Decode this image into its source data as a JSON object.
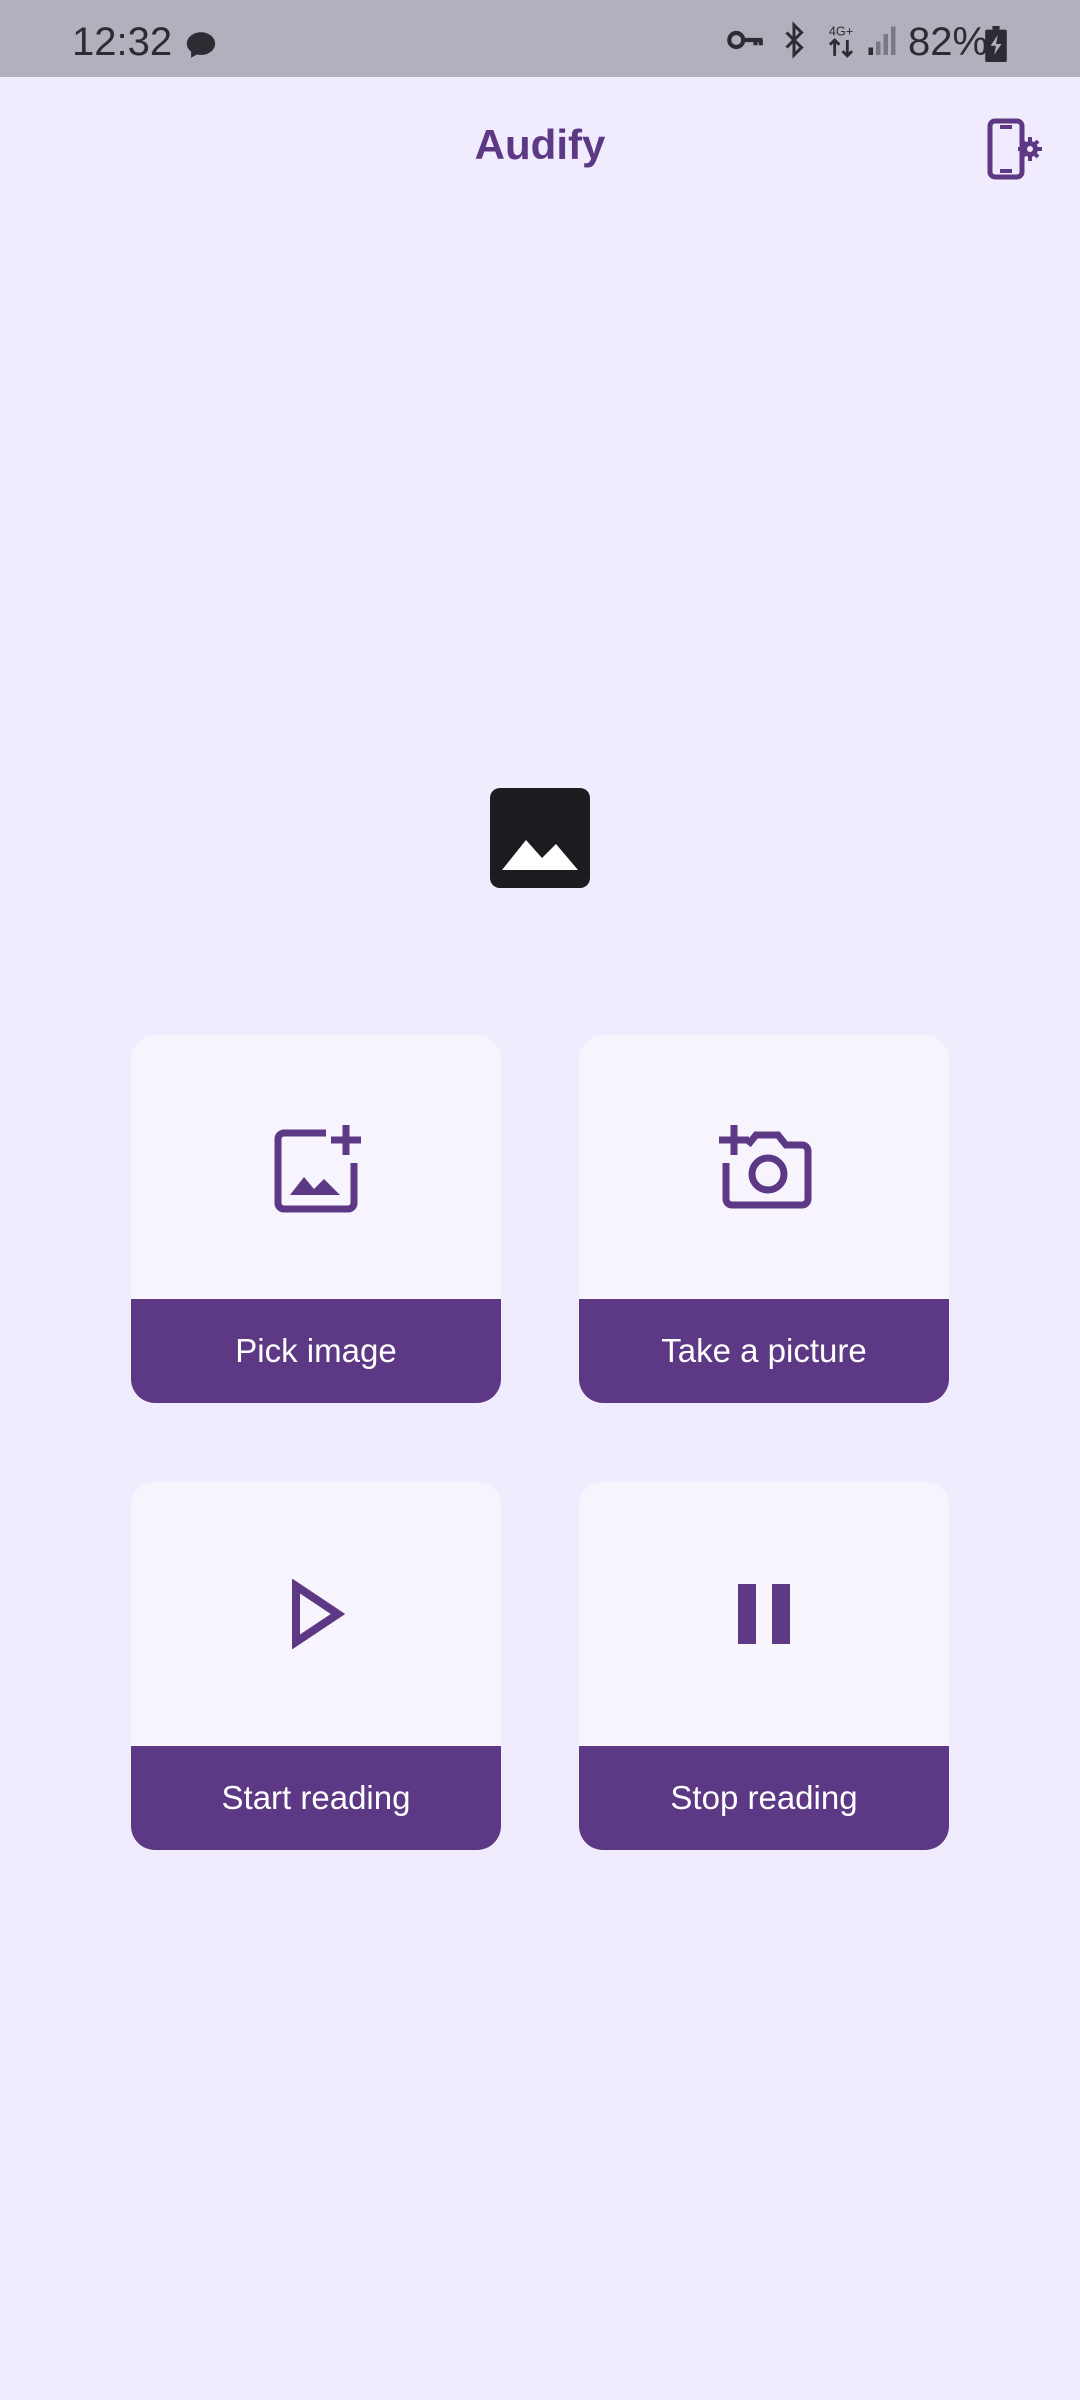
{
  "status_bar": {
    "time": "12:32",
    "battery": "82%",
    "network_label": "4G+",
    "icons": [
      "message-icon",
      "vpn-key-icon",
      "bluetooth-icon",
      "network-4g-icon",
      "signal-icon",
      "battery-charging-icon"
    ]
  },
  "app": {
    "title": "Audify",
    "accent_color": "#5d3884",
    "background_color": "#f1ecfd"
  },
  "actions": [
    {
      "label": "Pick image",
      "icon": "add-photo-icon"
    },
    {
      "label": "Take a picture",
      "icon": "add-camera-icon"
    },
    {
      "label": "Start reading",
      "icon": "play-icon"
    },
    {
      "label": "Stop reading",
      "icon": "pause-icon"
    }
  ],
  "preview": {
    "icon": "image-placeholder-icon"
  }
}
